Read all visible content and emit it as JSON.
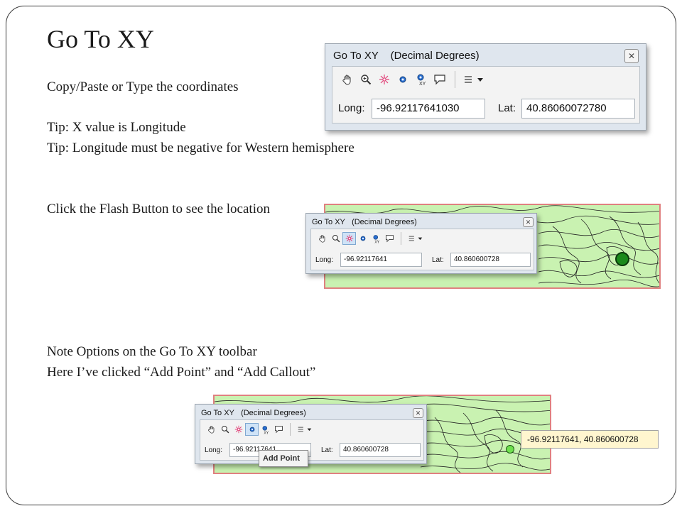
{
  "slide": {
    "title": "Go To XY",
    "lines": [
      "Copy/Paste or Type the coordinates",
      "Tip: X value is Longitude",
      "Tip: Longitude must be negative for Western hemisphere",
      "Click the Flash Button to see the location",
      "Note Options on the Go To XY toolbar",
      "Here I’ve clicked “Add Point” and “Add Callout”"
    ]
  },
  "dialog1": {
    "title": "Go To XY",
    "units": "(Decimal Degrees)",
    "long_label": "Long:",
    "long_value": "-96.92117641030",
    "lat_label": "Lat:",
    "lat_value": "40.86060072780",
    "tools": [
      "pan-icon",
      "zoom-icon",
      "flash-icon",
      "add-point-icon",
      "add-labeled-point-icon",
      "add-callout-icon",
      "options-menu-icon"
    ]
  },
  "dialog2": {
    "title": "Go To XY",
    "units": "(Decimal Degrees)",
    "long_label": "Long:",
    "long_value": "-96.92117641",
    "lat_label": "Lat:",
    "lat_value": "40.860600728",
    "active_tool": "flash-icon"
  },
  "dialog3": {
    "title": "Go To XY",
    "units": "(Decimal Degrees)",
    "long_label": "Long:",
    "long_value": "-96.92117641",
    "lat_label": "Lat:",
    "lat_value": "40.860600728",
    "active_tool": "add-point-icon",
    "tooltip": "Add Point"
  },
  "callout": {
    "text": "-96.92117641, 40.860600728"
  },
  "colors": {
    "map_fill": "#c9f2b1",
    "map_border": "#e08080",
    "flash_point": "#1a8a1a",
    "added_point": "#6fe04f",
    "callout_bg": "#fff6cf"
  }
}
